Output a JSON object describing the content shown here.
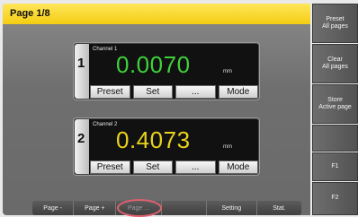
{
  "header": {
    "title": "Page 1/8",
    "accent_color": "#f4cd12"
  },
  "channels": [
    {
      "index": "1",
      "name": "Channel 1",
      "value": "0.0070",
      "unit": "mm",
      "value_color": "#3ed23a",
      "softkeys": [
        "Preset",
        "Set",
        "...",
        "Mode"
      ]
    },
    {
      "index": "2",
      "name": "Channel 2",
      "value": "0.4073",
      "unit": "mm",
      "value_color": "#e9d21c",
      "softkeys": [
        "Preset",
        "Set",
        "...",
        "Mode"
      ]
    }
  ],
  "bottom_nav": {
    "page_minus": "Page -",
    "page_plus": "Page +",
    "page_dots": "Page ...",
    "setting": "Setting",
    "stat": "Stat."
  },
  "side_panel": {
    "preset_line1": "Preset",
    "preset_line2": "All pages",
    "clear_line1": "Clear",
    "clear_line2": "All pages",
    "store_line1": "Store",
    "store_line2": "Active page",
    "f1": "F1",
    "f2": "F2"
  }
}
